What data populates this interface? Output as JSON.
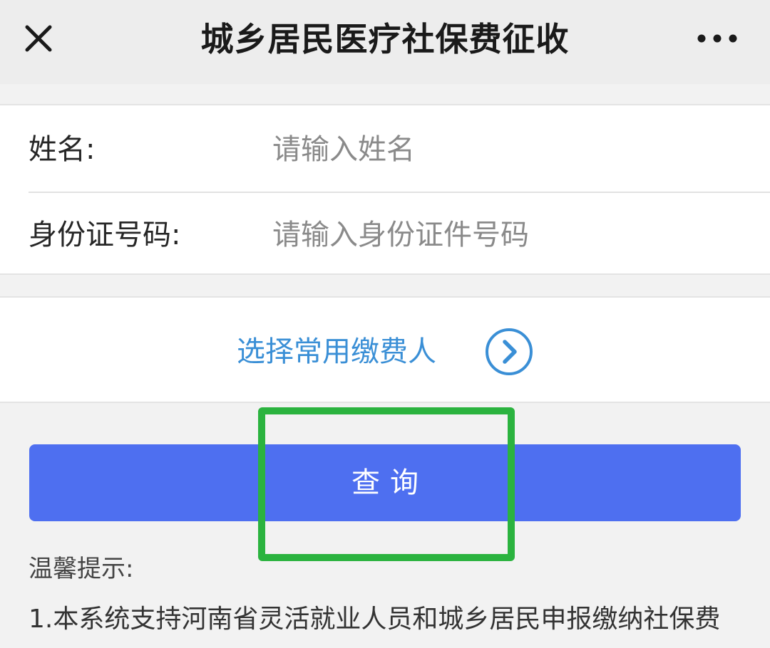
{
  "header": {
    "title": "城乡居民医疗社保费征收",
    "close_icon": "close-icon",
    "more_icon": "more-dots-icon"
  },
  "form": {
    "name_label": "姓名:",
    "name_placeholder": "请输入姓名",
    "name_value": "",
    "id_label": "身份证号码:",
    "id_placeholder": "请输入身份证件号码",
    "id_value": ""
  },
  "payer": {
    "label": "选择常用缴费人",
    "icon": "chevron-right-circle-icon"
  },
  "query": {
    "label": "查询"
  },
  "tips": {
    "title": "温馨提示:",
    "line1": "1.本系统支持河南省灵活就业人员和城乡居民申报缴纳社保费"
  },
  "colors": {
    "primary_button": "#4e6ff0",
    "link": "#3a8fd6",
    "highlight": "#2bb33f",
    "titlebar_bg": "#ededed",
    "page_bg": "#f2f2f2"
  }
}
